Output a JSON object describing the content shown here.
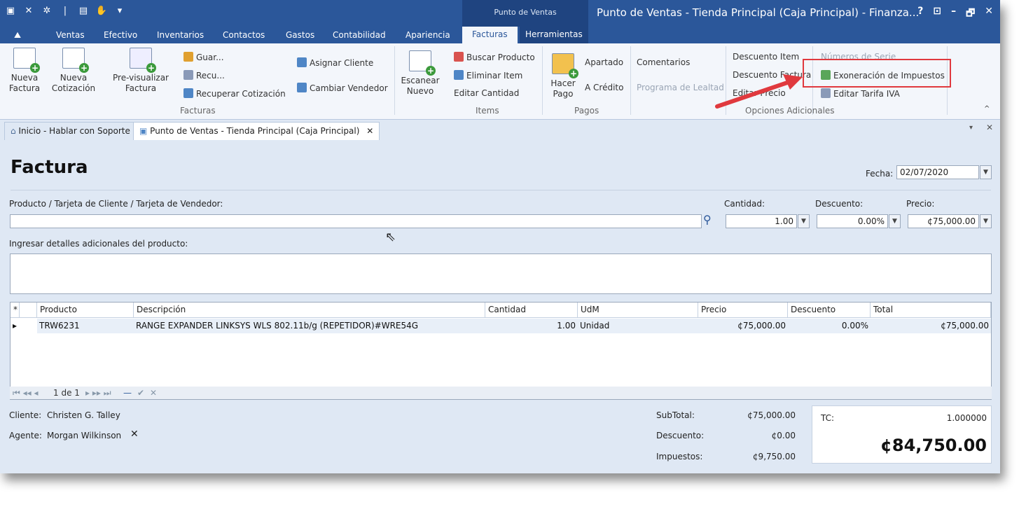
{
  "window": {
    "context_group": "Punto de Ventas",
    "title": "Punto de Ventas - Tienda Principal (Caja Principal) - Finanza...",
    "controls": [
      "?",
      "⊡",
      "–",
      "🗗",
      "✕"
    ]
  },
  "tabs": [
    "Ventas",
    "Efectivo",
    "Inventarios",
    "Contactos",
    "Gastos",
    "Contabilidad",
    "Apariencia",
    "Facturas",
    "Herramientas"
  ],
  "active_tab": "Facturas",
  "ribbon": {
    "facturas_group": {
      "label": "Facturas",
      "nueva_factura": [
        "Nueva",
        "Factura"
      ],
      "nueva_cotizacion": [
        "Nueva",
        "Cotización"
      ],
      "previsualizar": [
        "Pre-visualizar",
        "Factura"
      ],
      "guardar": "Guar...",
      "recu": "Recu...",
      "recuperar_cotizacion": "Recuperar Cotización",
      "asignar_cliente": "Asignar Cliente",
      "cambiar_vendedor": "Cambiar Vendedor"
    },
    "items_group": {
      "label": "Items",
      "escanear": [
        "Escanear",
        "Nuevo"
      ],
      "buscar_producto": "Buscar Producto",
      "eliminar_item": "Eliminar Item",
      "editar_cantidad": "Editar Cantidad"
    },
    "pagos_group": {
      "label": "Pagos",
      "hacer_pago": [
        "Hacer",
        "Pago"
      ],
      "apartado": "Apartado",
      "a_credito": "A Crédito"
    },
    "adicionales_group": {
      "label": "Opciones Adicionales",
      "comentarios": "Comentarios",
      "programa_lealtad": "Programa de Lealtad",
      "descuento_item": "Descuento Item",
      "descuento_factura": "Descuento Factura",
      "editar_precio": "Editar Precio",
      "numeros_serie": "Números de Serie",
      "exoneracion": "Exoneración de Impuestos",
      "editar_tarifa": "Editar Tarifa IVA"
    }
  },
  "doc_tabs": [
    "Inicio - Hablar con Soporte",
    "Punto de Ventas - Tienda Principal (Caja Principal)"
  ],
  "form": {
    "title": "Factura",
    "fecha_label": "Fecha:",
    "fecha_value": "02/07/2020",
    "producto_label": "Producto / Tarjeta de Cliente / Tarjeta de Vendedor:",
    "cantidad_label": "Cantidad:",
    "cantidad_value": "1.00",
    "descuento_label": "Descuento:",
    "descuento_value": "0.00%",
    "precio_label": "Precio:",
    "precio_value": "¢75,000.00",
    "detalles_label": "Ingresar detalles adicionales del producto:"
  },
  "grid": {
    "columns": [
      "Producto",
      "Descripción",
      "Cantidad",
      "UdM",
      "Precio",
      "Descuento",
      "Total"
    ],
    "rows": [
      [
        "TRW6231",
        "RANGE EXPANDER  LINKSYS WLS 802.11b/g (REPETIDOR)#WRE54G",
        "1.00",
        "Unidad",
        "¢75,000.00",
        "0.00%",
        "¢75,000.00"
      ]
    ],
    "pager_text": "1 de 1"
  },
  "footer": {
    "cliente_label": "Cliente:",
    "cliente_value": "Christen G. Talley",
    "agente_label": "Agente:",
    "agente_value": "Morgan Wilkinson",
    "subtotal_label": "SubTotal:",
    "subtotal_value": "¢75,000.00",
    "descuento_label": "Descuento:",
    "descuento_value": "¢0.00",
    "impuestos_label": "Impuestos:",
    "impuestos_value": "¢9,750.00",
    "tc_label": "TC:",
    "tc_value": "1.000000",
    "total_value": "¢84,750.00"
  },
  "colors": {
    "titlebar": "#2b579a",
    "highlight": "#e0393e",
    "ribbon_bg": "#f3f6fb"
  }
}
